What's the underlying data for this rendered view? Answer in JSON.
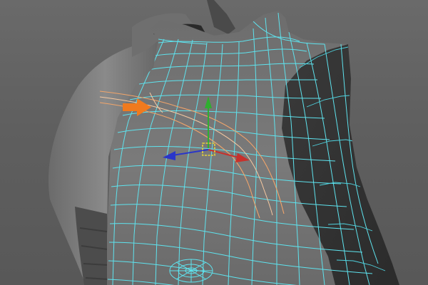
{
  "viewport": {
    "name": "3d-viewport",
    "background_color": "#5f5f5f"
  },
  "colors": {
    "wireframe": "#5ee3ee",
    "edge_loop_selection": "#f2a56a",
    "annotation_arrow": "#f07a1e",
    "gizmo_x_axis": "#c8312c",
    "gizmo_y_axis": "#2fae2f",
    "gizmo_z_axis": "#2a36c9",
    "gizmo_center": "#e8d23a",
    "unselected_mesh_shading": "#7b7b7b"
  },
  "objects": {
    "left_torso": "unselected-shaded-mesh",
    "right_chest_plate": "selected-wireframe-mesh",
    "move_manipulator": "translate-gizmo",
    "annotation": "arrow-icon"
  }
}
